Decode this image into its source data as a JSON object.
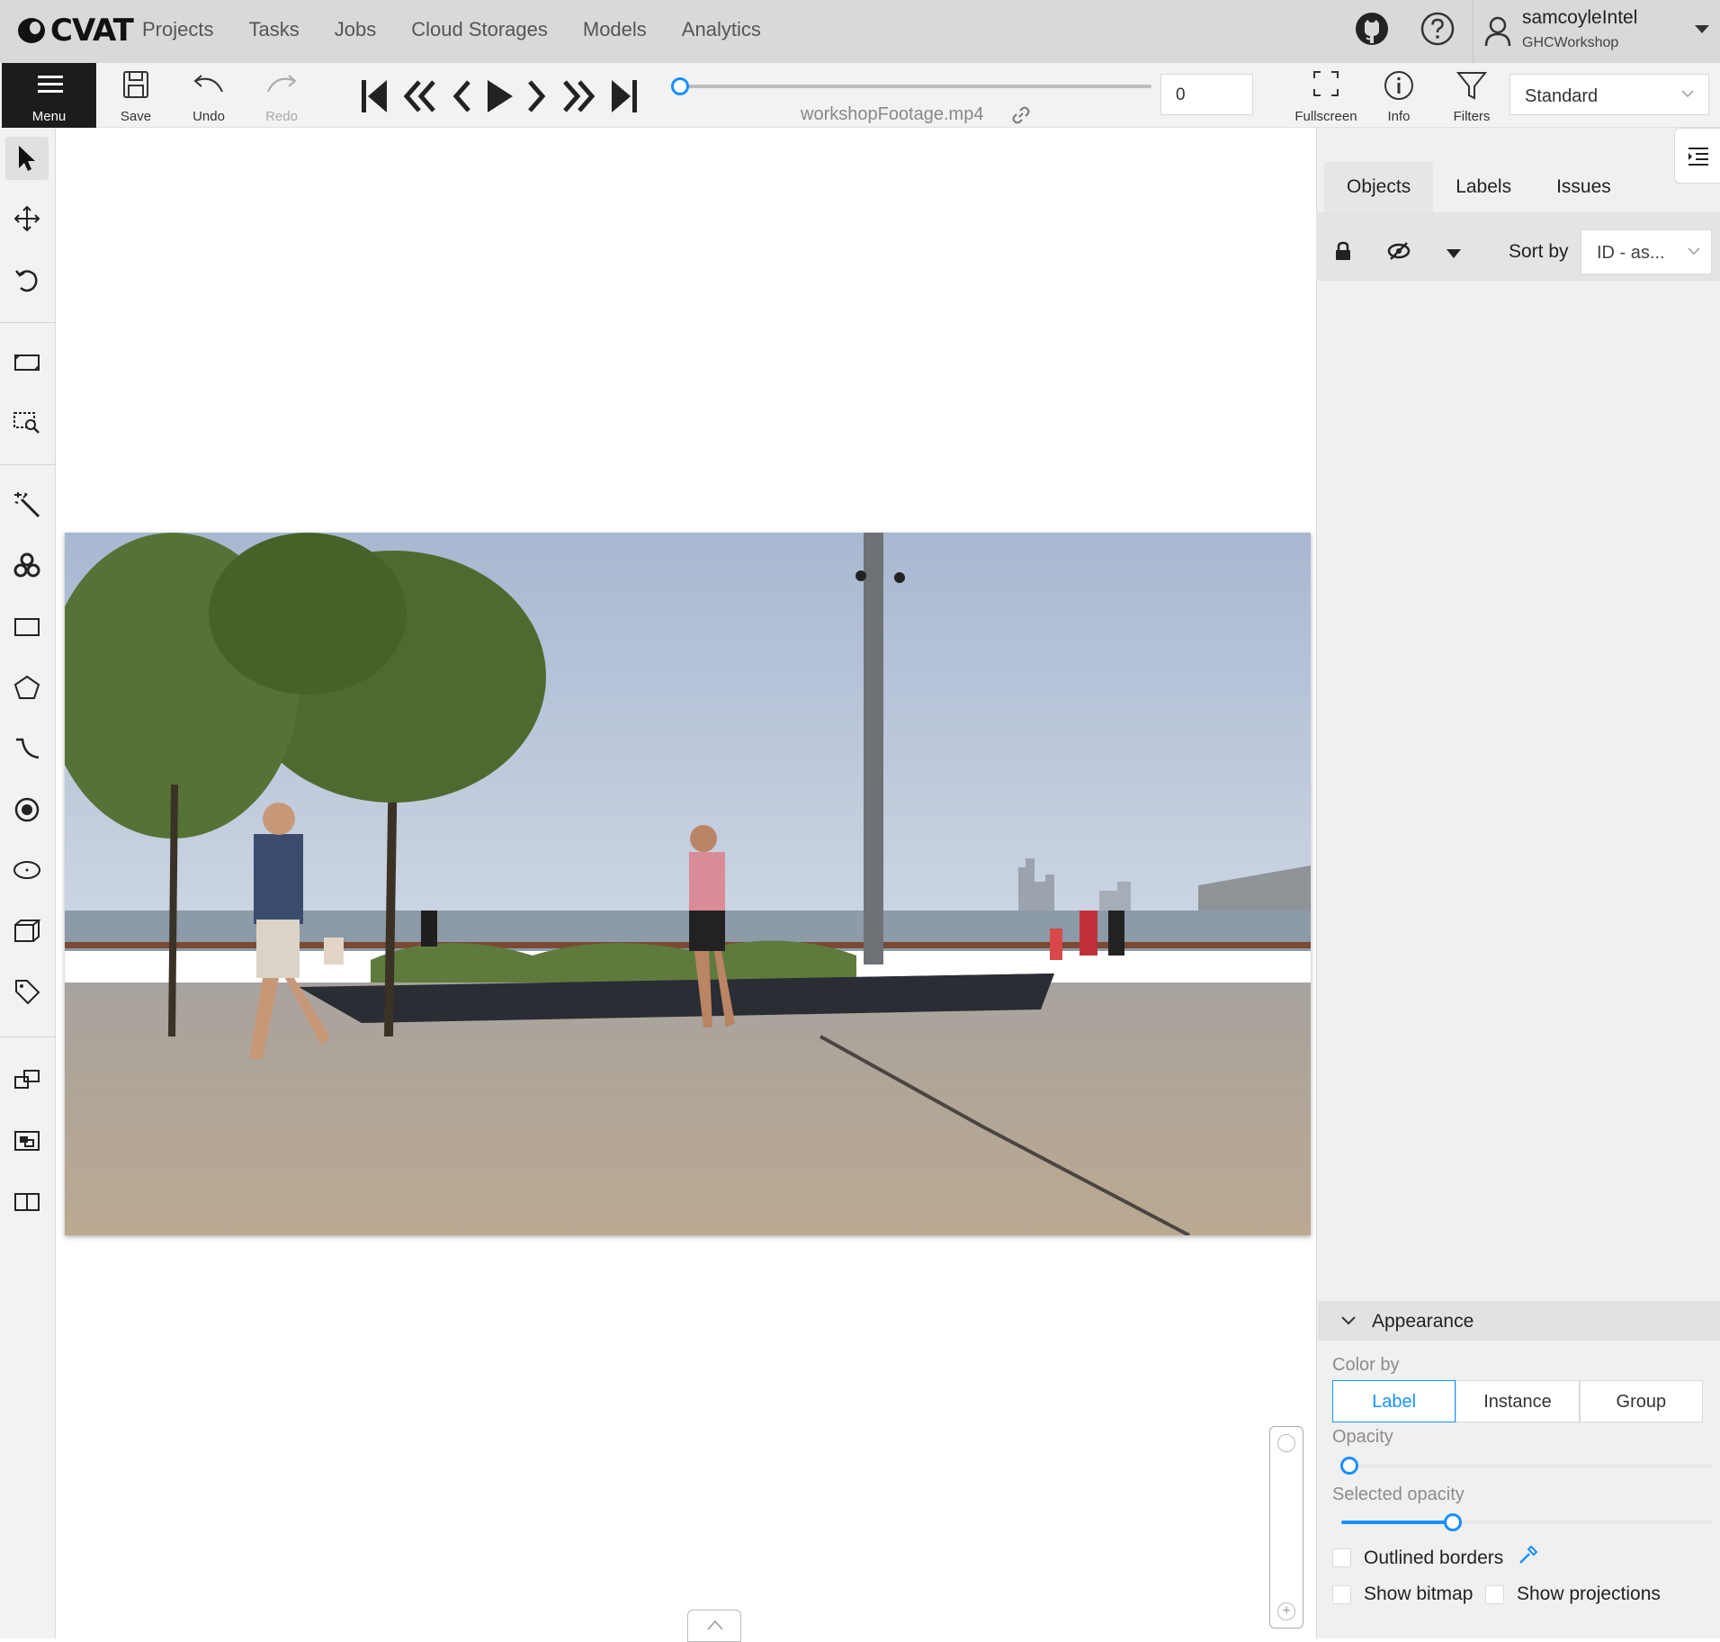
{
  "app": {
    "logo_text": "CVAT"
  },
  "nav": {
    "items": [
      "Projects",
      "Tasks",
      "Jobs",
      "Cloud Storages",
      "Models",
      "Analytics"
    ]
  },
  "user": {
    "name": "samcoyleIntel",
    "org": "GHCWorkshop"
  },
  "toolbar": {
    "menu_label": "Menu",
    "save_label": "Save",
    "undo_label": "Undo",
    "redo_label": "Redo",
    "filename": "workshopFootage.mp4",
    "frame_number": "0",
    "fullscreen_label": "Fullscreen",
    "info_label": "Info",
    "filters_label": "Filters",
    "workspace": "Standard"
  },
  "player": {
    "progress": 0.0
  },
  "sidebar": {
    "tabs": [
      "Objects",
      "Labels",
      "Issues"
    ],
    "active_tab": "Objects",
    "sort_by_label": "Sort by",
    "sort_value": "ID - as..."
  },
  "appearance": {
    "title": "Appearance",
    "color_by_label": "Color by",
    "color_by_options": [
      "Label",
      "Instance",
      "Group"
    ],
    "color_by_selected": "Label",
    "opacity_label": "Opacity",
    "opacity_value": 0.0,
    "selected_opacity_label": "Selected opacity",
    "selected_opacity_value": 0.3,
    "outlined_borders_label": "Outlined borders",
    "show_bitmap_label": "Show bitmap",
    "show_projections_label": "Show projections"
  },
  "colors": {
    "accent": "#1890ff",
    "topbar": "#d9d9d9",
    "menu_bg": "#1c1c1c"
  }
}
